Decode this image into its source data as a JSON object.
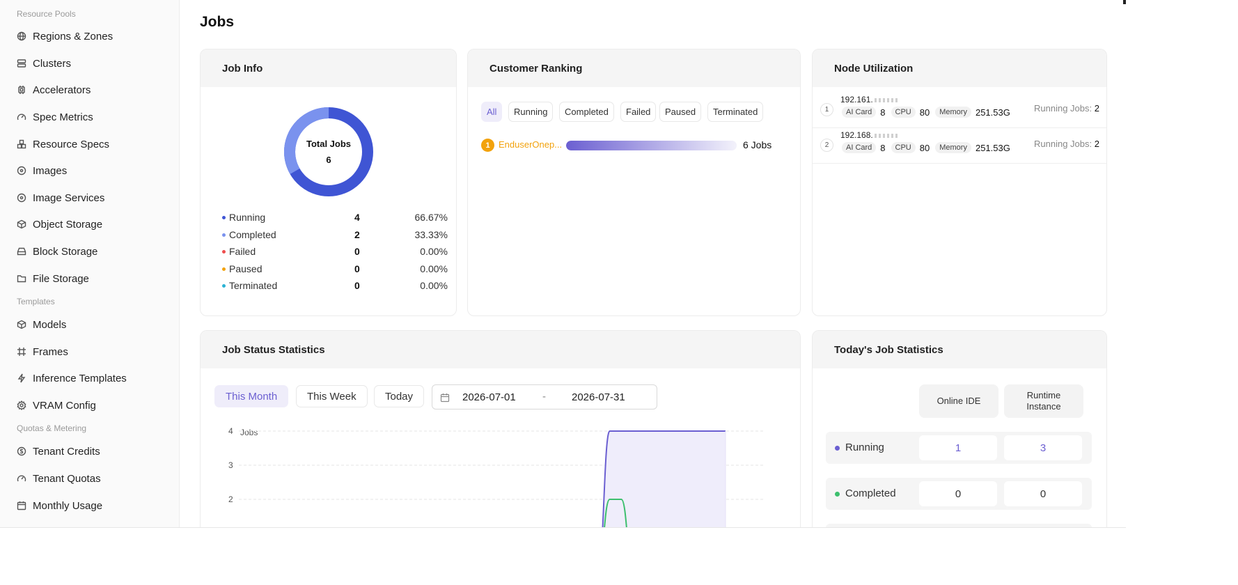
{
  "sidebar": {
    "groups": [
      "Resource Pools",
      "Templates",
      "Quotas & Metering"
    ],
    "items": [
      {
        "label": "Regions & Zones",
        "icon": "globe-icon"
      },
      {
        "label": "Clusters",
        "icon": "server-icon"
      },
      {
        "label": "Accelerators",
        "icon": "chip-icon"
      },
      {
        "label": "Spec Metrics",
        "icon": "gauge-icon"
      },
      {
        "label": "Resource Specs",
        "icon": "cubes-icon"
      },
      {
        "label": "Images",
        "icon": "disc-icon"
      },
      {
        "label": "Image Services",
        "icon": "disc-icon"
      },
      {
        "label": "Object Storage",
        "icon": "box-icon"
      },
      {
        "label": "Block Storage",
        "icon": "drive-icon"
      },
      {
        "label": "File Storage",
        "icon": "folder-icon"
      },
      {
        "label": "Models",
        "icon": "box-icon"
      },
      {
        "label": "Frames",
        "icon": "frame-icon"
      },
      {
        "label": "Inference Templates",
        "icon": "bolt-icon"
      },
      {
        "label": "VRAM Config",
        "icon": "gear-icon"
      },
      {
        "label": "Tenant Credits",
        "icon": "coin-icon"
      },
      {
        "label": "Tenant Quotas",
        "icon": "gauge-icon"
      },
      {
        "label": "Monthly Usage",
        "icon": "calendar-icon"
      }
    ]
  },
  "page": {
    "title": "Jobs"
  },
  "job_info": {
    "title": "Job Info",
    "donut_label": "Total Jobs",
    "total": "6",
    "rows": [
      {
        "label": "Running",
        "count": "4",
        "percent": "66.67%",
        "color": "#3f55d4"
      },
      {
        "label": "Completed",
        "count": "2",
        "percent": "33.33%",
        "color": "#7a92ee"
      },
      {
        "label": "Failed",
        "count": "0",
        "percent": "0.00%",
        "color": "#ee4d4d"
      },
      {
        "label": "Paused",
        "count": "0",
        "percent": "0.00%",
        "color": "#f2a20c"
      },
      {
        "label": "Terminated",
        "count": "0",
        "percent": "0.00%",
        "color": "#2bb3d4"
      }
    ]
  },
  "customer_ranking": {
    "title": "Customer Ranking",
    "filters": [
      "All",
      "Running",
      "Completed",
      "Failed",
      "Paused",
      "Terminated"
    ],
    "active_filter": "All",
    "entries": [
      {
        "rank": "1",
        "name": "EnduserOnep...",
        "value": "6 Jobs",
        "fraction": 1.0
      }
    ]
  },
  "node_utilization": {
    "title": "Node Utilization",
    "nodes": [
      {
        "index": "1",
        "ip": "192.161.",
        "ai_card_label": "AI Card",
        "ai_card": "8",
        "cpu_label": "CPU",
        "cpu": "80",
        "memory_label": "Memory",
        "memory": "251.53G",
        "running_label": "Running Jobs:",
        "running": "2"
      },
      {
        "index": "2",
        "ip": "192.168.",
        "ai_card_label": "AI Card",
        "ai_card": "8",
        "cpu_label": "CPU",
        "cpu": "80",
        "memory_label": "Memory",
        "memory": "251.53G",
        "running_label": "Running Jobs:",
        "running": "2"
      }
    ]
  },
  "job_status": {
    "title": "Job Status Statistics",
    "ranges": [
      "This Month",
      "This Week",
      "Today"
    ],
    "active_range": "This Month",
    "date_start": "2026-07-01",
    "date_sep": "-",
    "date_end": "2026-07-31"
  },
  "chart_data": {
    "type": "area",
    "ylabel": "Jobs",
    "yticks": [
      "4",
      "3",
      "2"
    ],
    "series": [
      {
        "color": "#6b5fd1",
        "values": [
          0,
          0,
          0,
          0,
          0,
          0,
          0,
          0,
          0,
          0,
          0,
          0,
          0,
          0,
          0,
          0,
          0,
          0,
          0,
          0,
          4,
          4,
          4,
          4,
          4,
          4,
          4,
          4,
          4,
          4,
          4
        ]
      },
      {
        "color": "#3dbf6e",
        "values": [
          0,
          0,
          0,
          0,
          0,
          0,
          0,
          0,
          0,
          0,
          0,
          0,
          0,
          0,
          0,
          0,
          0,
          0,
          0,
          0,
          2,
          2,
          0,
          0,
          0,
          0,
          0,
          0,
          0,
          0,
          0
        ]
      }
    ]
  },
  "today_stats": {
    "title": "Today's Job Statistics",
    "col1": "Online IDE",
    "col2": "Runtime Instance",
    "rows": [
      {
        "label": "Running",
        "color": "#6b5fd1",
        "v1": "1",
        "v2": "3"
      },
      {
        "label": "Completed",
        "color": "#3dbf6e",
        "v1": "0",
        "v2": "0"
      }
    ]
  }
}
